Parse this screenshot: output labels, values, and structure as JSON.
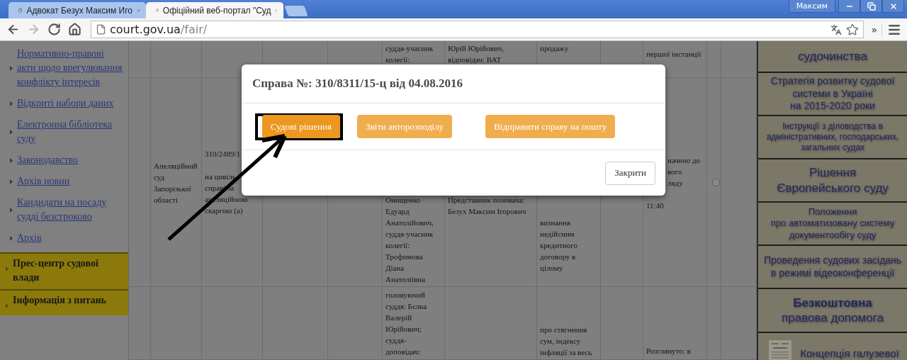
{
  "browser": {
    "tabs": [
      {
        "title": "Адвокат Безух Максим Иго",
        "selected": false
      },
      {
        "title": "Офіційний веб-портал \"Суд",
        "selected": true
      }
    ],
    "profile": "Максим",
    "window_controls": [
      {
        "kind": "minimize"
      },
      {
        "kind": "restore"
      },
      {
        "kind": "close"
      }
    ],
    "nav_buttons": [
      {
        "kind": "back",
        "disabled": false
      },
      {
        "kind": "forward",
        "disabled": true
      },
      {
        "kind": "reload",
        "disabled": false
      },
      {
        "kind": "home",
        "disabled": false
      }
    ],
    "address": {
      "host": "court.gov.ua",
      "path": "/fair/"
    },
    "overflow_label": "»"
  },
  "sidebar": {
    "links": [
      "Нормативно-правові акти щодо врегулювання конфлікту інтересів",
      "Відкриті набори даних",
      "Електронна бібліотека суду",
      "Законодавство",
      "Архів новин",
      "Кандидати на посаду судді безстроково",
      "Архів"
    ],
    "sections": [
      "Прес-центр судової влади",
      "Інформація з питань"
    ]
  },
  "table": {
    "rows": [
      {
        "column_6": "суддя-учасник\nколегії:",
        "column_7": "Юрій Юрійович,\nвідповідач: ВАТ",
        "column_8": "продажу",
        "column_10": "першої інстанції"
      },
      {
        "column_2": "Апеляційний\nсуд\nЗапорізької\nобласті",
        "column_3": "310/2489/1\n\nна цивіль\nсправі за\nапеляційною\nскаргою (а)",
        "column_6": "Онищенко\nЕдуард\nАнатолійович,\nсуддя-учасник\nколегії:\nТрофимова\nДіана\nАнатоліївна",
        "column_7": "Представник позивача:\nБезух Максим Ігорович",
        "column_8": "визнання\nнедійсним\nкредитного\nдоговору в\nцілому",
        "column_10": {
          "fragment": "начено до\nвого\nляду",
          "text": "11:40"
        },
        "column_11": {
          "kind": "radio",
          "selected": false
        }
      },
      {
        "column_6": "головуючий\nсуддя: Бєлка\nВалерій\nЮрійович;\nсуддя-\nдоповідач:",
        "column_8": "про стягнення\nсум, індексу\nінфляції за весь",
        "column_10": "Розглянуто: в"
      }
    ]
  },
  "right_panel": {
    "items": [
      {
        "text": "судочинства"
      },
      {
        "text": "Стратегія розвитку судової\nсистеми в Україні\nна 2015-2020 роки"
      },
      {
        "text": "Інструкції з діловодства в\nадміністративних, господарських,\nзагальних судах"
      },
      {
        "text": "Рішення\nЄвропейського суду"
      },
      {
        "text": "Положення\nпро автоматизовану систему\nдокументообігу суду"
      },
      {
        "text": "Проведення судових засідань\nв режимі відеоконференції"
      },
      {
        "text": "**Безкоштовна**\nправова допомога"
      },
      {
        "text": "Концепція галузевої",
        "kind": "picture"
      }
    ]
  },
  "modal": {
    "title": "Справа №: 310/8311/15-ц від 04.08.2016",
    "buttons": [
      {
        "label": "Судові рішення",
        "active": true,
        "annotated": true
      },
      {
        "label": "Звіти авторозподілу",
        "active": false,
        "annotated": false
      },
      {
        "label": "Відправити справу на пошту",
        "active": false,
        "annotated": false
      }
    ],
    "close_label": "Закрити"
  }
}
